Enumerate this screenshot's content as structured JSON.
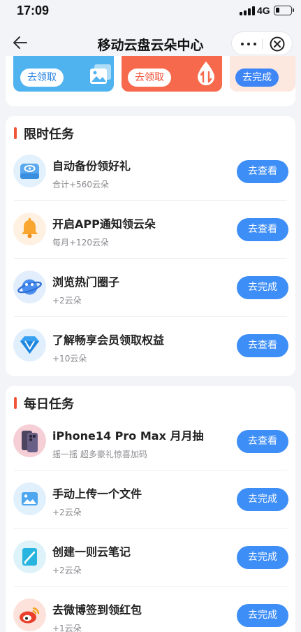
{
  "status_bar": {
    "time": "17:09",
    "network": "4G"
  },
  "nav": {
    "title": "移动云盘云朵中心"
  },
  "banner": {
    "promos": [
      {
        "label": "去领取",
        "icon": "image-frames-icon"
      },
      {
        "label": "去领取",
        "icon": "transfer-drop-icon"
      },
      {
        "label": "去完成"
      }
    ]
  },
  "limited": {
    "title": "限时任务",
    "tasks": [
      {
        "title": "自动备份领好礼",
        "subtitle": "合计+560云朵",
        "button": "去查看",
        "icon": "backup-disk-icon"
      },
      {
        "title": "开启APP通知领云朵",
        "subtitle": "每月+120云朵",
        "button": "去查看",
        "icon": "bell-icon"
      },
      {
        "title": "浏览热门圈子",
        "subtitle": "+2云朵",
        "button": "去完成",
        "icon": "planet-icon"
      },
      {
        "title": "了解畅享会员领取权益",
        "subtitle": "+10云朵",
        "button": "去查看",
        "icon": "diamond-icon"
      }
    ]
  },
  "daily": {
    "title": "每日任务",
    "tasks": [
      {
        "title": "iPhone14 Pro Max 月月抽",
        "subtitle": "摇一摇 超多豪礼惊喜加码",
        "button": "去查看",
        "icon": "phone-photo-icon"
      },
      {
        "title": "手动上传一个文件",
        "subtitle": "+2云朵",
        "button": "去完成",
        "icon": "upload-image-icon"
      },
      {
        "title": "创建一则云笔记",
        "subtitle": "+2云朵",
        "button": "去完成",
        "icon": "note-pen-icon"
      },
      {
        "title": "去微博签到领红包",
        "subtitle": "+1云朵",
        "button": "去完成",
        "icon": "weibo-icon"
      }
    ]
  },
  "colors": {
    "accent_blue": "#3e8ef7",
    "section_marker": "#f0563a",
    "page_bg": "#f3f4f8",
    "promo_blue": "#4fb3f0",
    "promo_orange": "#f7694c"
  }
}
